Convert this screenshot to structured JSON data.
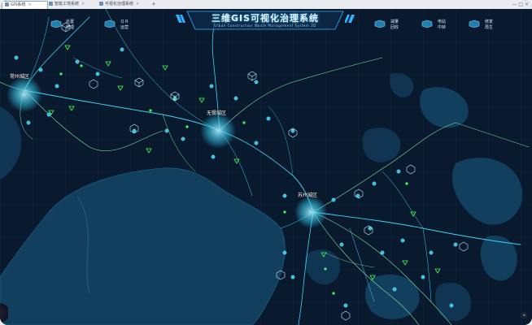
{
  "browser": {
    "tabs": [
      {
        "label": "GIS系统",
        "close": "×"
      },
      {
        "label": "智能工地系统",
        "close": "×"
      },
      {
        "label": "可视化治理系统",
        "close": "×"
      }
    ],
    "new_tab": "+",
    "window_controls": "—  □  ×"
  },
  "header": {
    "title": "三维GIS可视化治理系统",
    "subtitle": "Urban Construction Waste Management System 3D"
  },
  "nav": {
    "left": [
      {
        "line1": "处置",
        "line2": "管理",
        "icon": "truck-icon"
      },
      {
        "line1": "Q R",
        "line2": "运营",
        "icon": "site-icon"
      }
    ],
    "right": [
      {
        "line1": "减量",
        "line2": "回收",
        "icon": "recycle-icon"
      },
      {
        "line1": "电站",
        "line2": "中转",
        "icon": "station-icon"
      },
      {
        "line1": "修复",
        "line2": "再生",
        "icon": "regen-icon"
      }
    ]
  },
  "cities": [
    {
      "name": "常州城区"
    },
    {
      "name": "无锡城区"
    },
    {
      "name": "苏州城区"
    }
  ],
  "colors": {
    "land": "#0a1a2e",
    "water": "#123f5e",
    "water_deep": "#0f3552",
    "road_main": "#3fd4f4",
    "road_minor": "#7fe3a0",
    "marker_site": "#29c6e8",
    "marker_green": "#3cff5a",
    "title_glow": "#2fb3ff"
  }
}
